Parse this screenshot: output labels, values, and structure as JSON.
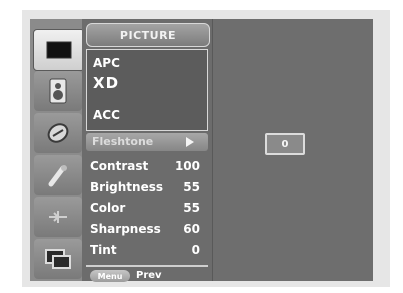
{
  "menu": {
    "title": "PICTURE",
    "submenu": [
      "APC",
      "XD",
      "ACC"
    ],
    "selected": {
      "label": "Fleshtone",
      "value": "0"
    },
    "settings": [
      {
        "label": "Contrast",
        "value": "100"
      },
      {
        "label": "Brightness",
        "value": "55"
      },
      {
        "label": "Color",
        "value": "55"
      },
      {
        "label": "Sharpness",
        "value": "60"
      },
      {
        "label": "Tint",
        "value": "0"
      }
    ],
    "footer": {
      "key_label": "Menu",
      "action_label": "Prev"
    }
  },
  "icons": [
    "picture-menu-icon",
    "audio-speaker-icon",
    "time-clock-icon",
    "special-setup-icon",
    "option-screen-icon",
    "pip-icon"
  ],
  "colors": {
    "panel": "#6c6c6c",
    "frame": "#e6e6e6",
    "highlight": "#a8a8a8",
    "text": "#ffffff"
  }
}
